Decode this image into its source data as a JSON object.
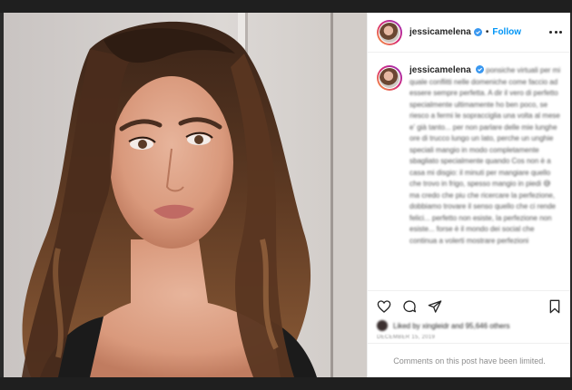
{
  "post": {
    "username": "jessicamelena",
    "follow_label": "Follow",
    "separator": "•",
    "caption": "ponsiche virtuali per mi quale conflitti nelle domeniche come faccio ad essere sempre perfetta. A dir il vero di perfetto specialmente ultimamente ho ben poco, se riesco a fermi le sopracciglia una volta al mese e' già tanto... per non parlare delle mie lunghe ore di trucco lungo un lato, perche un unghie speciali mangio in modo completamente sbagliato specialmente quando Cos non è a casa mi disgio: il minuti per mangiare quello che trovo in frigo, spesso mangio in piedi 😅 ma credo che piu che ricercare la perfezione, dobbiamo trovare il senso quello che ci rende felici... perfetto non esiste, la perfezione non esiste... forse è il mondo dei social che continua a volerti mostrare perfezioni",
    "likes_text": "Liked by xingleidr and 95,646 others",
    "date": "DECEMBER 15, 2019",
    "comments_limited": "Comments on this post have been limited."
  },
  "icons": {
    "verified": "verified-badge-icon",
    "more": "more-options-icon",
    "like": "heart-icon",
    "comment": "comment-icon",
    "share": "share-icon",
    "save": "bookmark-icon"
  },
  "colors": {
    "follow_blue": "#0095f6",
    "verified_blue": "#3897f0",
    "text_primary": "#262626",
    "text_secondary": "#8e8e8e"
  }
}
